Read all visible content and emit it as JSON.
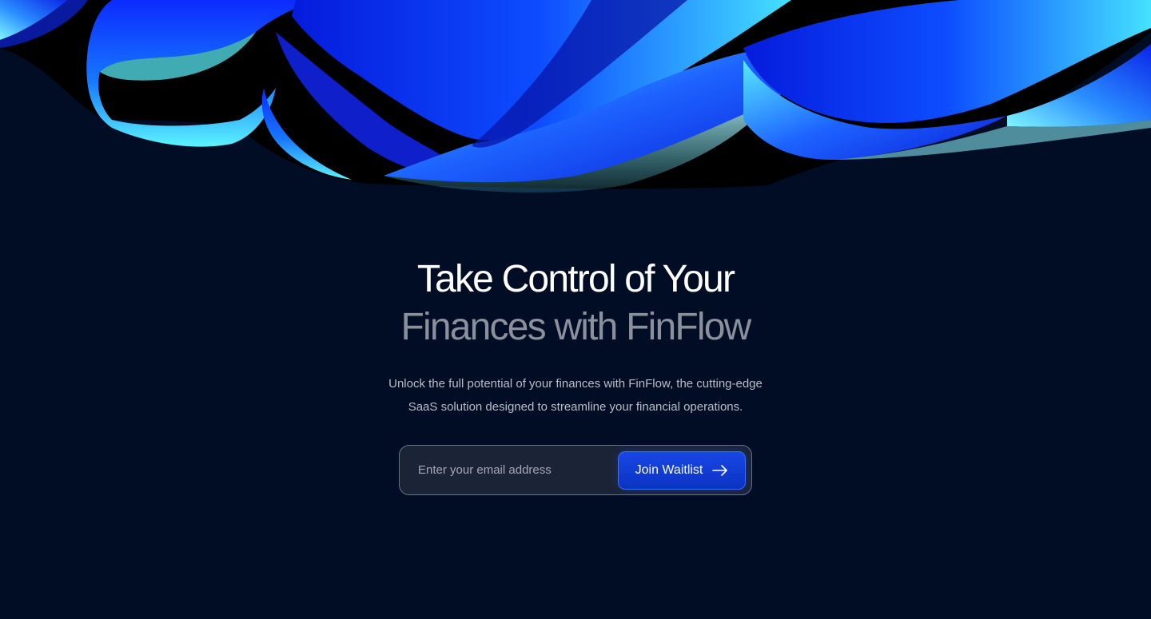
{
  "hero": {
    "headline_line1": "Take Control of Your",
    "headline_line2": "Finances with FinFlow",
    "subtitle_line1": "Unlock the full potential of your finances with FinFlow, the cutting-edge",
    "subtitle_line2": "SaaS solution designed to streamline your financial operations."
  },
  "form": {
    "email_placeholder": "Enter your email address",
    "email_value": "",
    "submit_label": "Join Waitlist",
    "submit_icon": "arrow-right-icon"
  },
  "colors": {
    "background": "#010d25",
    "accent_blue": "#1947e5",
    "ribbon_cyan": "#40e9ff",
    "headline_primary": "#ffffff",
    "headline_secondary": "#8a909c"
  }
}
